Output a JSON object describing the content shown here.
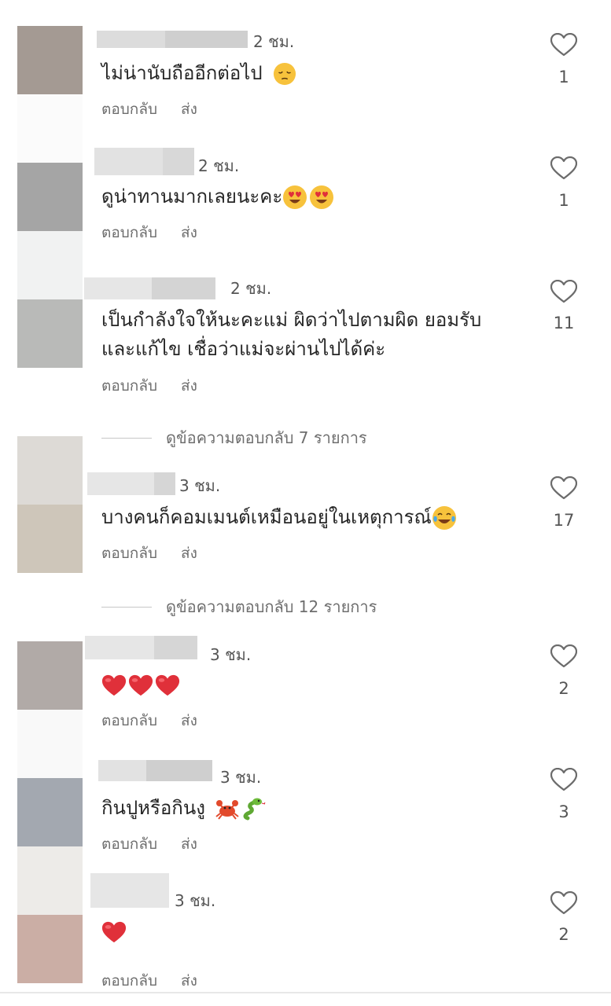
{
  "comments": [
    {
      "time": "2 ชม.",
      "text": "ไม่น่านับถืออีกต่อไป",
      "emoji": [
        "pensive-face"
      ],
      "reply_label": "ตอบกลับ",
      "send_label": "ส่ง",
      "likes": "1"
    },
    {
      "time": "2 ชม.",
      "text": "ดูน่าทานมากเลยนะคะ",
      "emoji": [
        "heart-eyes-face",
        "heart-eyes-face"
      ],
      "reply_label": "ตอบกลับ",
      "send_label": "ส่ง",
      "likes": "1"
    },
    {
      "time": "2 ชม.",
      "text_line1": "เป็นกำลังใจให้นะคะแม่ ผิดว่าไปตามผิด ยอมรับ",
      "text_line2": "และแก้ไข เชื่อว่าแม่จะผ่านไปได้ค่ะ",
      "reply_label": "ตอบกลับ",
      "send_label": "ส่ง",
      "likes": "11"
    },
    {
      "time": "3 ชม.",
      "text": "บางคนก็คอมเมนต์เหมือนอยู่ในเหตุการณ์",
      "emoji": [
        "tears-of-joy-face"
      ],
      "reply_label": "ตอบกลับ",
      "send_label": "ส่ง",
      "likes": "17"
    },
    {
      "time": "3 ชม.",
      "text": "",
      "emoji": [
        "red-heart",
        "red-heart",
        "red-heart"
      ],
      "reply_label": "ตอบกลับ",
      "send_label": "ส่ง",
      "likes": "2"
    },
    {
      "time": "3 ชม.",
      "text": "กินปูหรือกินงู",
      "emoji": [
        "crab",
        "snake"
      ],
      "reply_label": "ตอบกลับ",
      "send_label": "ส่ง",
      "likes": "3"
    },
    {
      "time": "3 ชม.",
      "text": "",
      "emoji": [
        "red-heart"
      ],
      "reply_label": "ตอบกลับ",
      "send_label": "ส่ง",
      "likes": "2"
    }
  ],
  "view_replies": [
    {
      "label": "ดูข้อความตอบกลับ 7 รายการ"
    },
    {
      "label": "ดูข้อความตอบกลับ 12 รายการ"
    }
  ],
  "colors": {
    "text": "#262626",
    "muted": "#6e6e6e",
    "heart_red": "#e0303a",
    "emoji_yellow": "#f7c23c"
  }
}
